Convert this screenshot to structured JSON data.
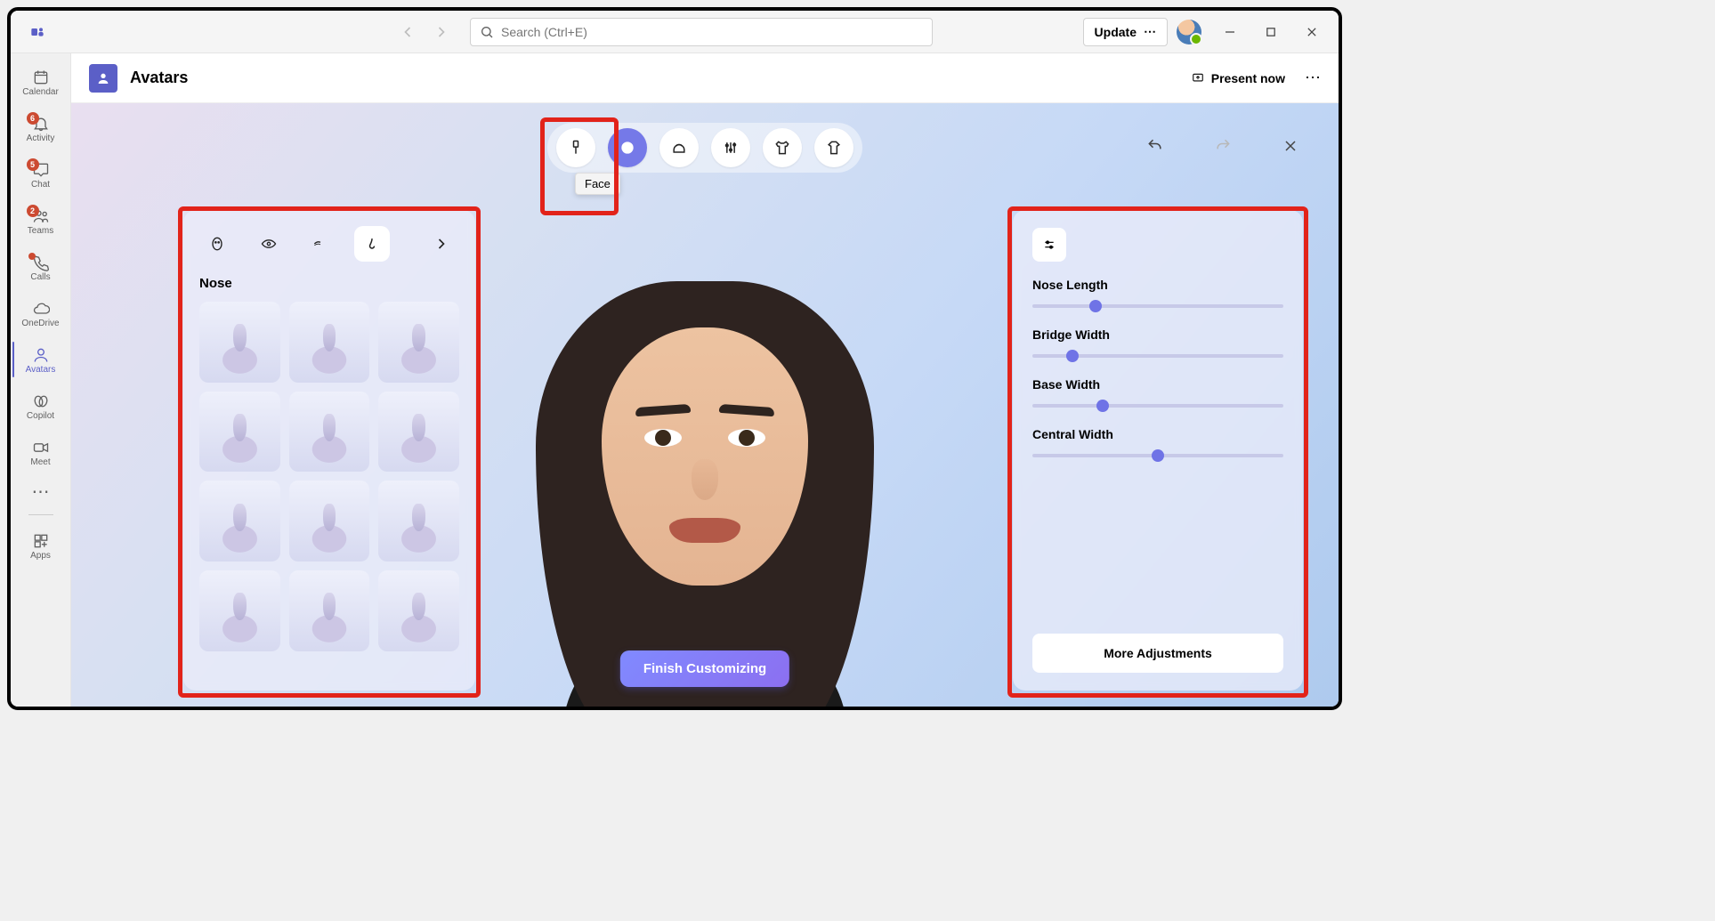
{
  "titlebar": {
    "search_placeholder": "Search (Ctrl+E)",
    "update_label": "Update"
  },
  "nav_rail": {
    "items": [
      {
        "label": "Calendar",
        "badge": null,
        "dot": false,
        "active": false
      },
      {
        "label": "Activity",
        "badge": "6",
        "dot": false,
        "active": false
      },
      {
        "label": "Chat",
        "badge": "5",
        "dot": false,
        "active": false
      },
      {
        "label": "Teams",
        "badge": "2",
        "dot": false,
        "active": false
      },
      {
        "label": "Calls",
        "badge": null,
        "dot": true,
        "active": false
      },
      {
        "label": "OneDrive",
        "badge": null,
        "dot": false,
        "active": false
      },
      {
        "label": "Avatars",
        "badge": null,
        "dot": false,
        "active": true
      },
      {
        "label": "Copilot",
        "badge": null,
        "dot": false,
        "active": false
      },
      {
        "label": "Meet",
        "badge": null,
        "dot": false,
        "active": false
      }
    ],
    "apps_label": "Apps"
  },
  "page_header": {
    "title": "Avatars",
    "present_label": "Present now"
  },
  "categories": {
    "active_index": 1,
    "tooltip_label": "Face"
  },
  "left_panel": {
    "section_title": "Nose",
    "thumb_count": 12
  },
  "right_panel": {
    "sliders": [
      {
        "label": "Nose Length",
        "value": 25
      },
      {
        "label": "Bridge Width",
        "value": 16
      },
      {
        "label": "Base Width",
        "value": 28
      },
      {
        "label": "Central Width",
        "value": 50
      }
    ],
    "more_label": "More Adjustments"
  },
  "finish_label": "Finish Customizing",
  "colors": {
    "accent": "#6f73e6",
    "highlight_red": "#e2231a"
  }
}
